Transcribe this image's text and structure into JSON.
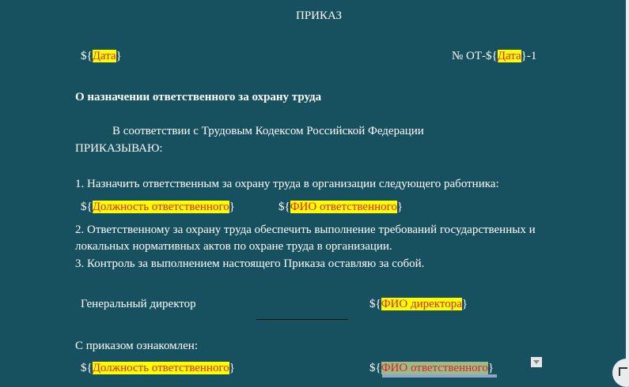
{
  "title": "ПРИКАЗ",
  "header": {
    "date_prefix": "${",
    "date_field": "Дата",
    "date_suffix": "}",
    "number_prefix": "№  ОТ-${",
    "number_field": "Дата",
    "number_suffix": "}-1"
  },
  "subject": "О назначении ответственного за охрану труда",
  "intro_line1": "В соответствии с   Трудовым Кодексом Российской Федерации",
  "intro_line2": "ПРИКАЗЫВАЮ:",
  "item1": "1. Назначить ответственным за охрану труда в организации следующего работника:",
  "responsible": {
    "position_prefix": "${",
    "position_field": "Должность ответственного",
    "position_suffix": "}",
    "name_prefix": "${",
    "name_field": "ФИО ответственного",
    "name_suffix": "}"
  },
  "item2_line1": "2. Ответственному за охрану труда обеспечить выполнение требований государственных и",
  "item2_line2": "локальных нормативных актов по охране труда в организации.",
  "item3": "3. Контроль за выполнением настоящего Приказа оставляю за собой.",
  "signature": {
    "role": "Генеральный директор",
    "name_prefix": "${",
    "name_field": "ФИО директора",
    "name_suffix": "}"
  },
  "acquainted": {
    "label": "С приказом ознакомлен:",
    "position_prefix": "${",
    "position_field": "Должность ответственного",
    "position_suffix": "}",
    "name_prefix": "${",
    "name_field": "ФИО ответственного",
    "name_suffix": "}"
  }
}
